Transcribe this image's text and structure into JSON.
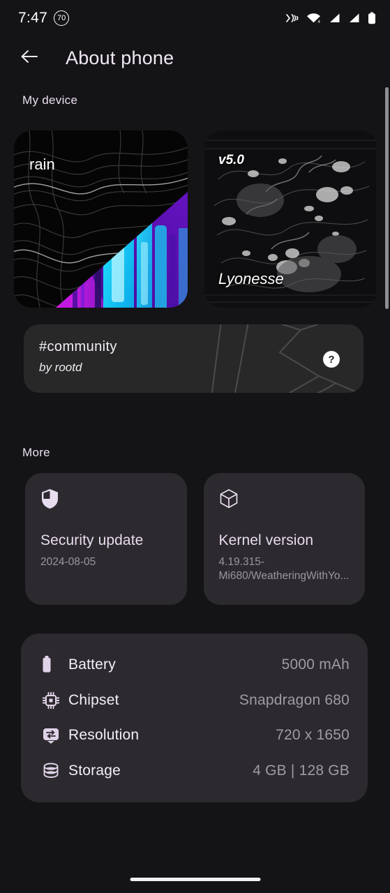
{
  "statusbar": {
    "time": "7:47",
    "badge": "70",
    "icons": [
      "nfc-icon",
      "wifi-icon",
      "signal-1-icon",
      "signal-2-icon",
      "battery-icon"
    ]
  },
  "header": {
    "back_icon": "arrow-back-icon",
    "title": "About phone"
  },
  "sections": {
    "my_device": "My device",
    "more": "More"
  },
  "device_cards": [
    {
      "label": "rain",
      "name": "wallpaper-card-rain"
    },
    {
      "version": "v5.0",
      "label": "Lyonesse",
      "name": "rom-card-lyonesse"
    }
  ],
  "community": {
    "title": "#community",
    "subtitle": "by rootd",
    "help": "?"
  },
  "more_cards": [
    {
      "icon": "shield-icon",
      "title": "Security update",
      "value": "2024-08-05"
    },
    {
      "icon": "cube-icon",
      "title": "Kernel version",
      "value": "4.19.315-Mi680/WeatheringWithYo..."
    }
  ],
  "specs": [
    {
      "icon": "battery-icon",
      "label": "Battery",
      "value": "5000 mAh"
    },
    {
      "icon": "chipset-icon",
      "label": "Chipset",
      "value": "Snapdragon 680"
    },
    {
      "icon": "resolution-icon",
      "label": "Resolution",
      "value": "720 x 1650"
    },
    {
      "icon": "storage-icon",
      "label": "Storage",
      "value": "4 GB | 128 GB"
    }
  ],
  "colors": {
    "background": "#141316",
    "card": "#2c2a2e",
    "banner": "#292829",
    "accent": "#e8dcef",
    "muted": "#9b969e"
  }
}
